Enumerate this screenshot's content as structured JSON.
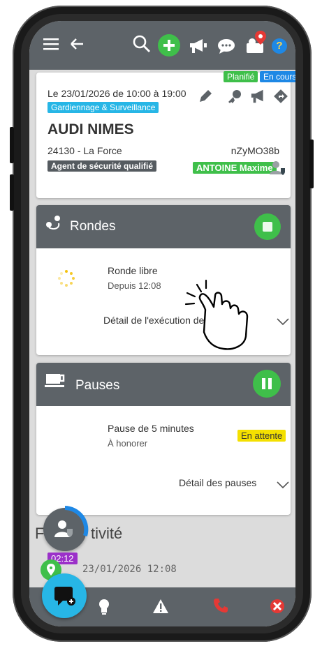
{
  "header": {
    "menu_icon": "menu-icon",
    "back_icon": "back-arrow-icon",
    "search_icon": "search-icon",
    "add_icon": "plus-icon",
    "megaphone_icon": "megaphone-icon",
    "chat_icon": "chat-icon",
    "agents_icon": "agents-location-icon",
    "help_icon": "help-icon",
    "help_label": "?"
  },
  "mission": {
    "status_planned": "Planifié",
    "status_in_progress": "En cours",
    "schedule": "Le 23/01/2026 de 10:00 à 19:00",
    "category": "Gardiennage & Surveillance",
    "client": "AUDI NIMES",
    "location": "24130 - La Force",
    "code": "nZyMO38b",
    "role": "Agent de sécurité qualifié",
    "agent": "ANTOINE Maxime"
  },
  "rounds": {
    "title": "Rondes",
    "item_title": "Ronde libre",
    "item_since": "Depuis 12:08",
    "detail_link": "Détail de l'exécution des rondes"
  },
  "pauses": {
    "title": "Pauses",
    "item_title": "Pause de 5 minutes",
    "item_sub": "À honorer",
    "badge": "En attente",
    "detail_link": "Détail des pauses"
  },
  "activity": {
    "title_partial": "F",
    "title_rest": "tivité",
    "timer": "02:12",
    "entry_date": "23/01/2026 12:08"
  },
  "colors": {
    "bar": "#5d6368",
    "green": "#3fbf4a",
    "cyan": "#27b6e6",
    "yellow": "#f4e000",
    "purple": "#9b30c9",
    "blue": "#1e88e5"
  }
}
